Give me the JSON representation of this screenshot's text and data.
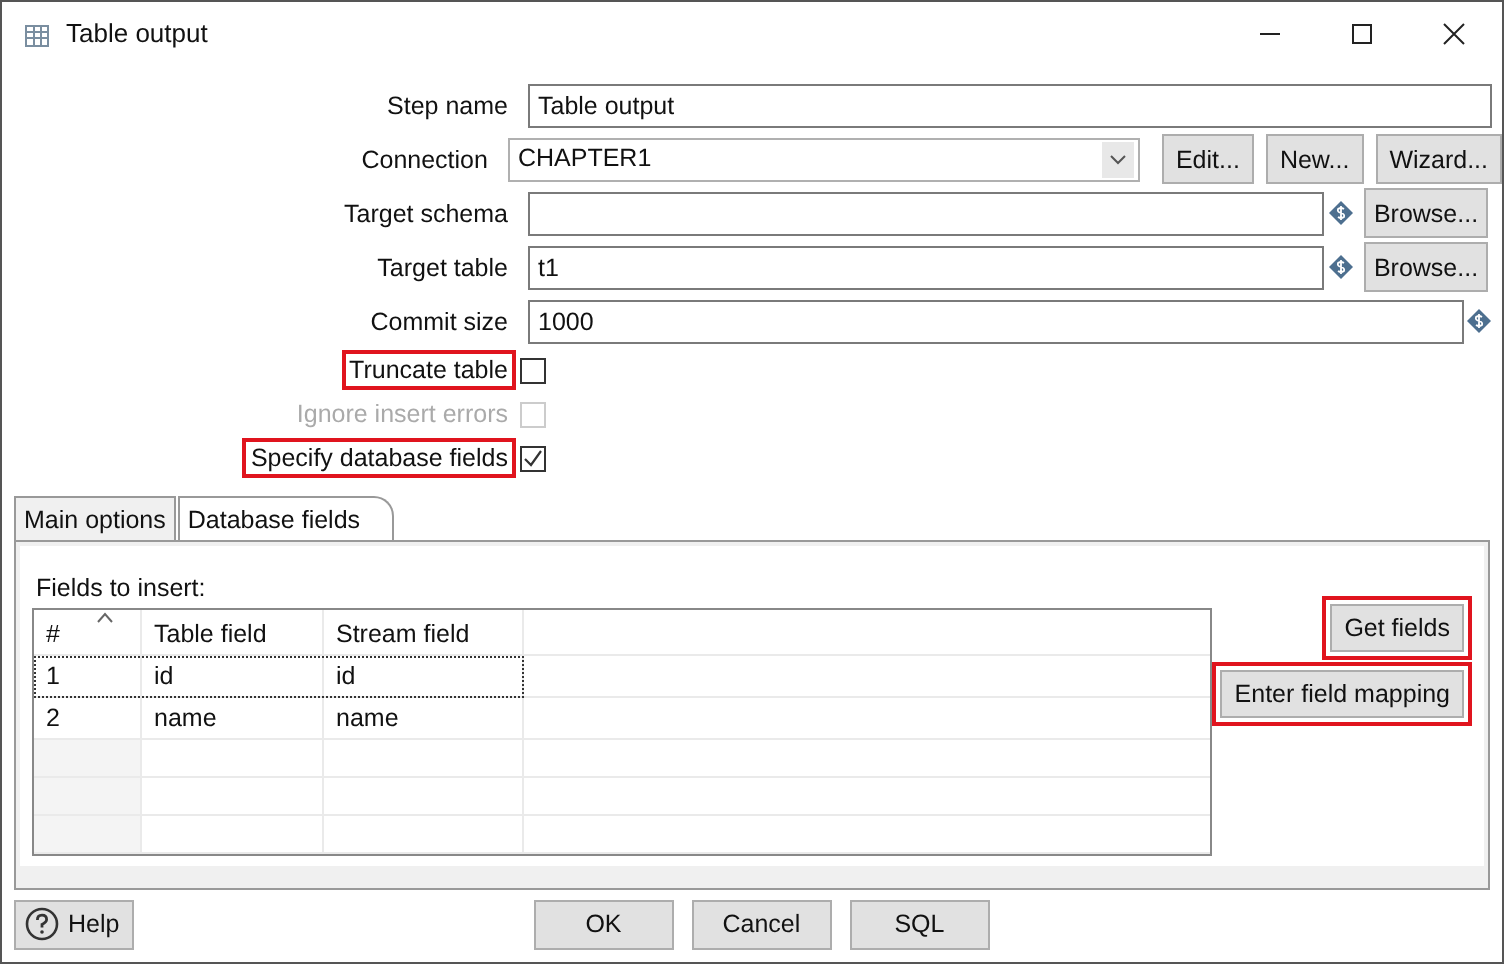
{
  "window": {
    "title": "Table output"
  },
  "form": [
    {
      "kind": "text",
      "label": "Step name",
      "value": "Table output",
      "highlighted": false
    },
    {
      "kind": "combo",
      "label": "Connection",
      "value": "CHAPTER1",
      "highlighted": false,
      "buttons": [
        "Edit...",
        "New...",
        "Wizard..."
      ]
    },
    {
      "kind": "text",
      "label": "Target schema",
      "variable": true,
      "browse": "Browse...",
      "highlighted": false
    },
    {
      "kind": "text",
      "label": "Target table",
      "value": "t1",
      "variable": true,
      "browse": "Browse...",
      "highlighted": false
    },
    {
      "kind": "text",
      "label": "Commit size",
      "value": "1000",
      "variable": true,
      "highlighted": false
    },
    {
      "kind": "checkbox",
      "label": "Truncate table",
      "checked": false,
      "disabled": false,
      "highlighted": true
    },
    {
      "kind": "checkbox",
      "label": "Ignore insert errors",
      "checked": false,
      "disabled": true,
      "highlighted": false
    },
    {
      "kind": "checkbox",
      "label": "Specify database fields",
      "checked": true,
      "disabled": false,
      "highlighted": true
    }
  ],
  "tabs": [
    {
      "label": "Main options",
      "selected": false
    },
    {
      "label": "Database fields",
      "selected": true
    }
  ],
  "fields_label": "Fields to insert:",
  "table": {
    "columns": [
      {
        "label": "#",
        "sorted": true
      },
      {
        "label": "Table field",
        "sorted": false
      },
      {
        "label": "Stream field",
        "sorted": false
      }
    ],
    "rows": [
      {
        "cells": [
          "1",
          "id",
          "id"
        ],
        "focused": true
      },
      {
        "cells": [
          "2",
          "name",
          "name"
        ],
        "focused": false
      }
    ]
  },
  "side_buttons": [
    {
      "label": "Get fields",
      "highlighted": true
    },
    {
      "label": "Enter field mapping",
      "highlighted": true
    }
  ],
  "help": "Help",
  "buttons": [
    "OK",
    "Cancel",
    "SQL"
  ]
}
